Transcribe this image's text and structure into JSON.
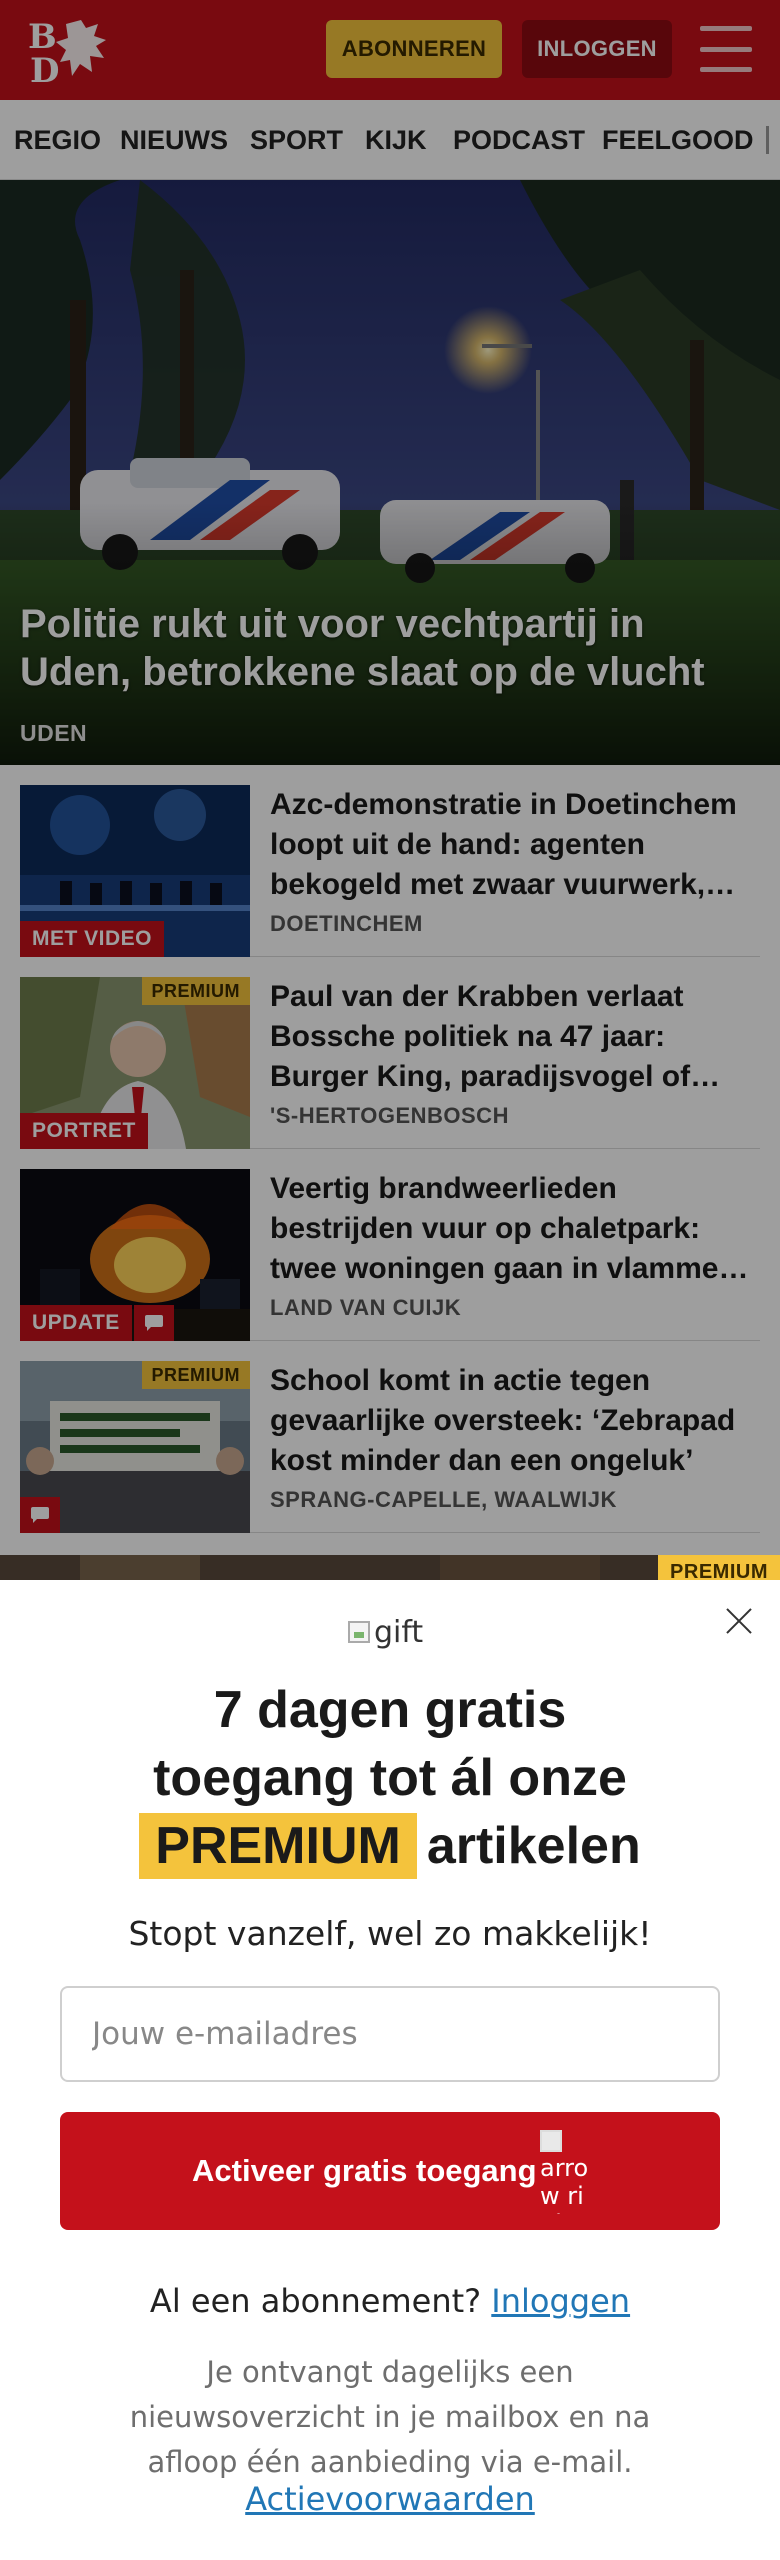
{
  "header": {
    "logo_text": "BD",
    "subscribe_label": "ABONNEREN",
    "login_label": "INLOGGEN"
  },
  "nav": {
    "items": [
      {
        "label": "REGIO"
      },
      {
        "label": "NIEUWS"
      },
      {
        "label": "SPORT"
      },
      {
        "label": "KIJK"
      },
      {
        "label": "PODCAST"
      },
      {
        "label": "FEELGOOD"
      }
    ]
  },
  "hero": {
    "title": "Politie rukt uit voor vechtpartij in Uden, betrokkene slaat op de vlucht",
    "location": "UDEN"
  },
  "articles": [
    {
      "headline": "Azc-demonstratie in Doetinchem loopt uit de hand: agenten bekogeld met zwaar vuurwerk, rellen, ME grijpt in",
      "location": "DOETINCHEM",
      "tag": "MET VIDEO",
      "premium": ""
    },
    {
      "headline": "Paul van der Krabben verlaat Bossche politiek na 47 jaar: Burger King, paradijsvogel of ultiem gezicht",
      "location": "'S-HERTOGENBOSCH",
      "tag": "PORTRET",
      "premium": "PREMIUM"
    },
    {
      "headline": "Veertig brandweerlieden bestrijden vuur op chaletpark: twee woningen gaan in vlammen op",
      "location": "LAND VAN CUIJK",
      "tag": "UPDATE",
      "premium": ""
    },
    {
      "headline": "School komt in actie tegen gevaarlijke oversteek: ‘Zebrapad kost minder dan een ongeluk’",
      "location": "SPRANG-CAPELLE, WAALWIJK",
      "tag": "",
      "premium": "PREMIUM"
    }
  ],
  "peek": {
    "premium": "PREMIUM"
  },
  "modal": {
    "gift_alt": "gift",
    "title_line1": "7 dagen gratis",
    "title_line2": "toegang tot ál onze",
    "title_highlight": "PREMIUM",
    "title_tail": "artikelen",
    "subtitle": "Stopt vanzelf, wel zo makkelijk!",
    "email_placeholder": "Jouw e-mailadres",
    "cta_label": "Activeer gratis toegang",
    "cta_icon_alt": "arrow right",
    "already_text": "Al een abonnement?",
    "already_link": "Inloggen",
    "note": "Je ontvangt dagelijks een nieuwsoverzicht in je mailbox en na afloop één aanbieding via e-mail.",
    "terms": "Actievoorwaarden"
  },
  "colors": {
    "brand_red": "#c4111b",
    "premium_yellow": "#f4c33c",
    "link_blue": "#2177b6"
  }
}
